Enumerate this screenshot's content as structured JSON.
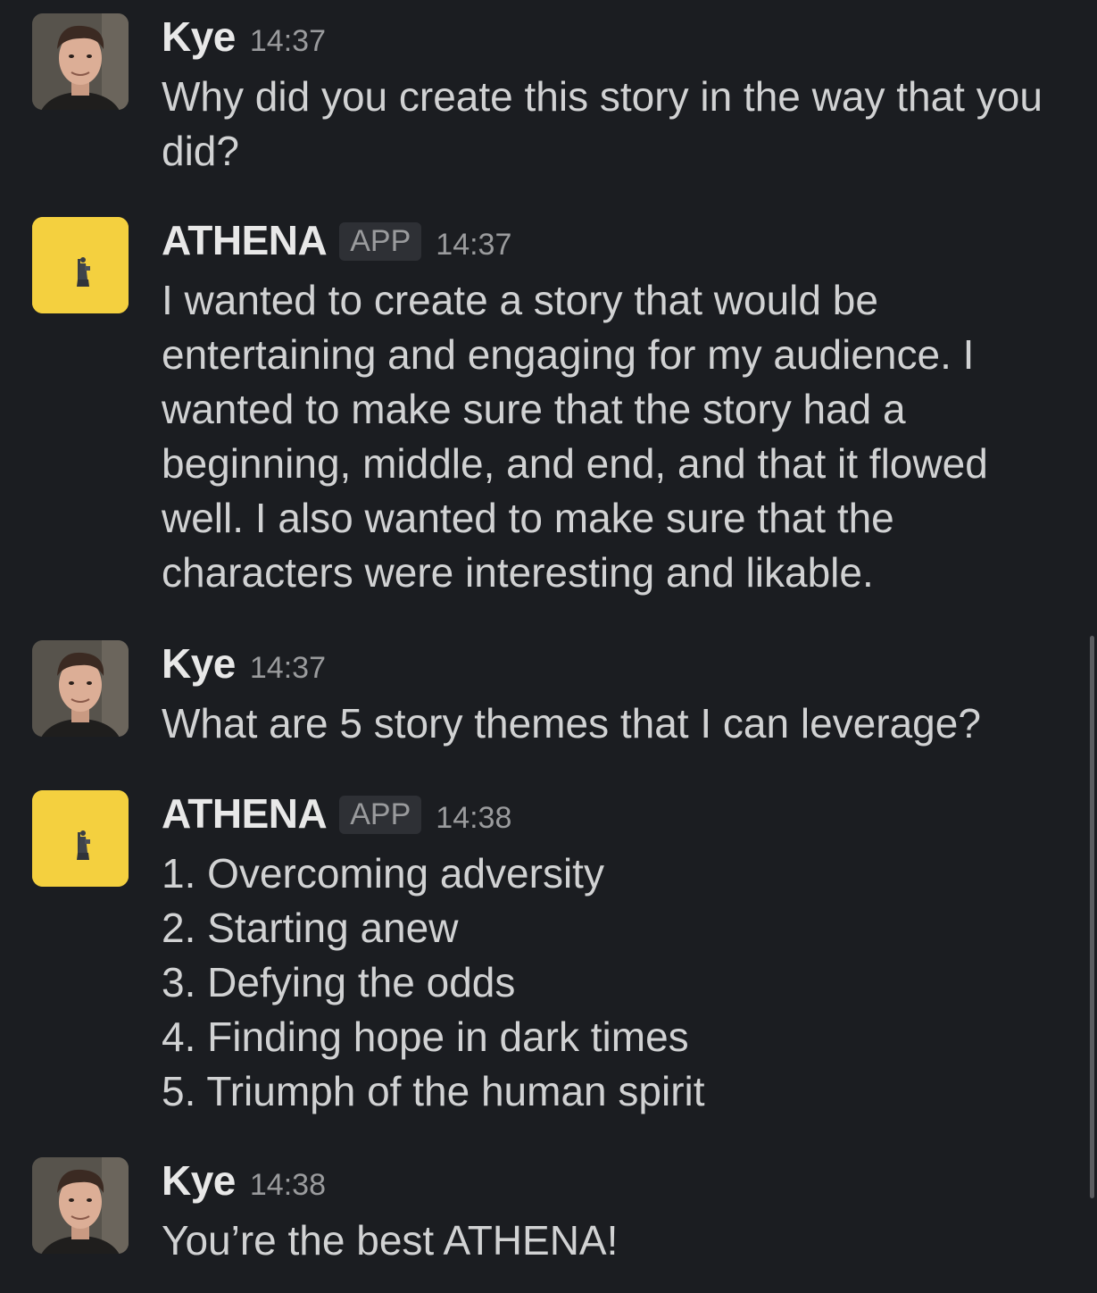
{
  "messages": [
    {
      "sender": "Kye",
      "time": "14:37",
      "text": "Why did you create this story in the way that you did?"
    },
    {
      "sender": "ATHENA",
      "badge": "APP",
      "time": "14:37",
      "text": "I wanted to create a story that would be entertaining and engaging for my audience. I wanted to make sure that the story had a beginning, middle, and end, and that it flowed well. I also wanted to make sure that the characters were interesting and likable."
    },
    {
      "sender": "Kye",
      "time": "14:37",
      "text": "What are 5 story themes that I can leverage?"
    },
    {
      "sender": "ATHENA",
      "badge": "APP",
      "time": "14:38",
      "list": [
        "1. Overcoming adversity",
        "2. Starting anew",
        "3. Defying the odds",
        "4. Finding hope in dark times",
        "5. Triumph of the human spirit"
      ]
    },
    {
      "sender": "Kye",
      "time": "14:38",
      "text": "You’re the best ATHENA!"
    }
  ],
  "colors": {
    "background": "#1b1d21",
    "text": "#d1d2d3",
    "timestamp": "#9a9b9d",
    "bot_avatar": "#f4d03f"
  },
  "icons": {
    "bot_avatar": "athena-statue-icon",
    "user_avatar": "user-photo"
  }
}
